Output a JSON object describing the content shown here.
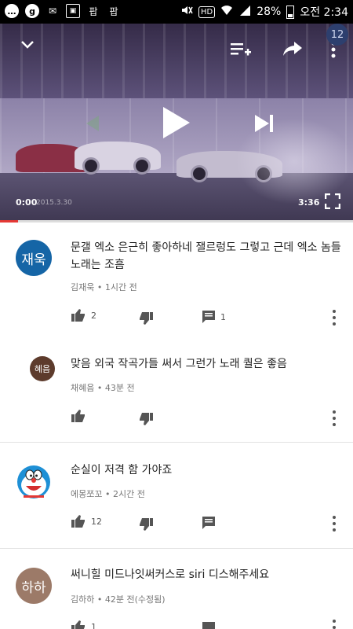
{
  "status_bar": {
    "left_icons": [
      "chat-icon",
      "g-icon",
      "mail-icon",
      "image-icon",
      "text-icon-1",
      "text-icon-2"
    ],
    "left_glyphs": [
      "…",
      "g",
      "✉",
      "▣",
      "팝",
      "팝"
    ],
    "right": {
      "percent": "28%",
      "time": "오전 2:34",
      "hd": "HD"
    }
  },
  "video": {
    "badge": "12",
    "current_time": "0:00",
    "duration": "3:36",
    "date_watermark": "2015.3.30",
    "progress": 0.05
  },
  "comments": [
    {
      "avatar_text": "재욱",
      "avatar_color": "#1565a6",
      "text": "문갤 엑소 은근히 좋아하네 잴르렁도 그렇고 근데 엑소 놈들 노래는 조흠",
      "meta": "김재욱 • 1시간 전",
      "likes": "2",
      "replies": "1"
    },
    {
      "avatar_text": "혜음",
      "avatar_color": "#5d3b2c",
      "text": "맞음 외국 작곡가들 써서 그런가 노래 퀄은 좋음",
      "meta": "채혜음 • 43분 전",
      "likes": "",
      "replies": ""
    },
    {
      "avatar_text": "",
      "avatar_color": "#1e90d6",
      "text": "순실이 저격 함 가야죠",
      "meta": "에몽쪼꼬 • 2시간 전",
      "likes": "12",
      "replies": ""
    },
    {
      "avatar_text": "하하",
      "avatar_color": "#9c7a68",
      "text": "써니힐 미드나잇써커스로 siri 디스해주세요",
      "meta": "김하하 • 42분 전(수정됨)",
      "likes": "1",
      "replies": ""
    }
  ]
}
